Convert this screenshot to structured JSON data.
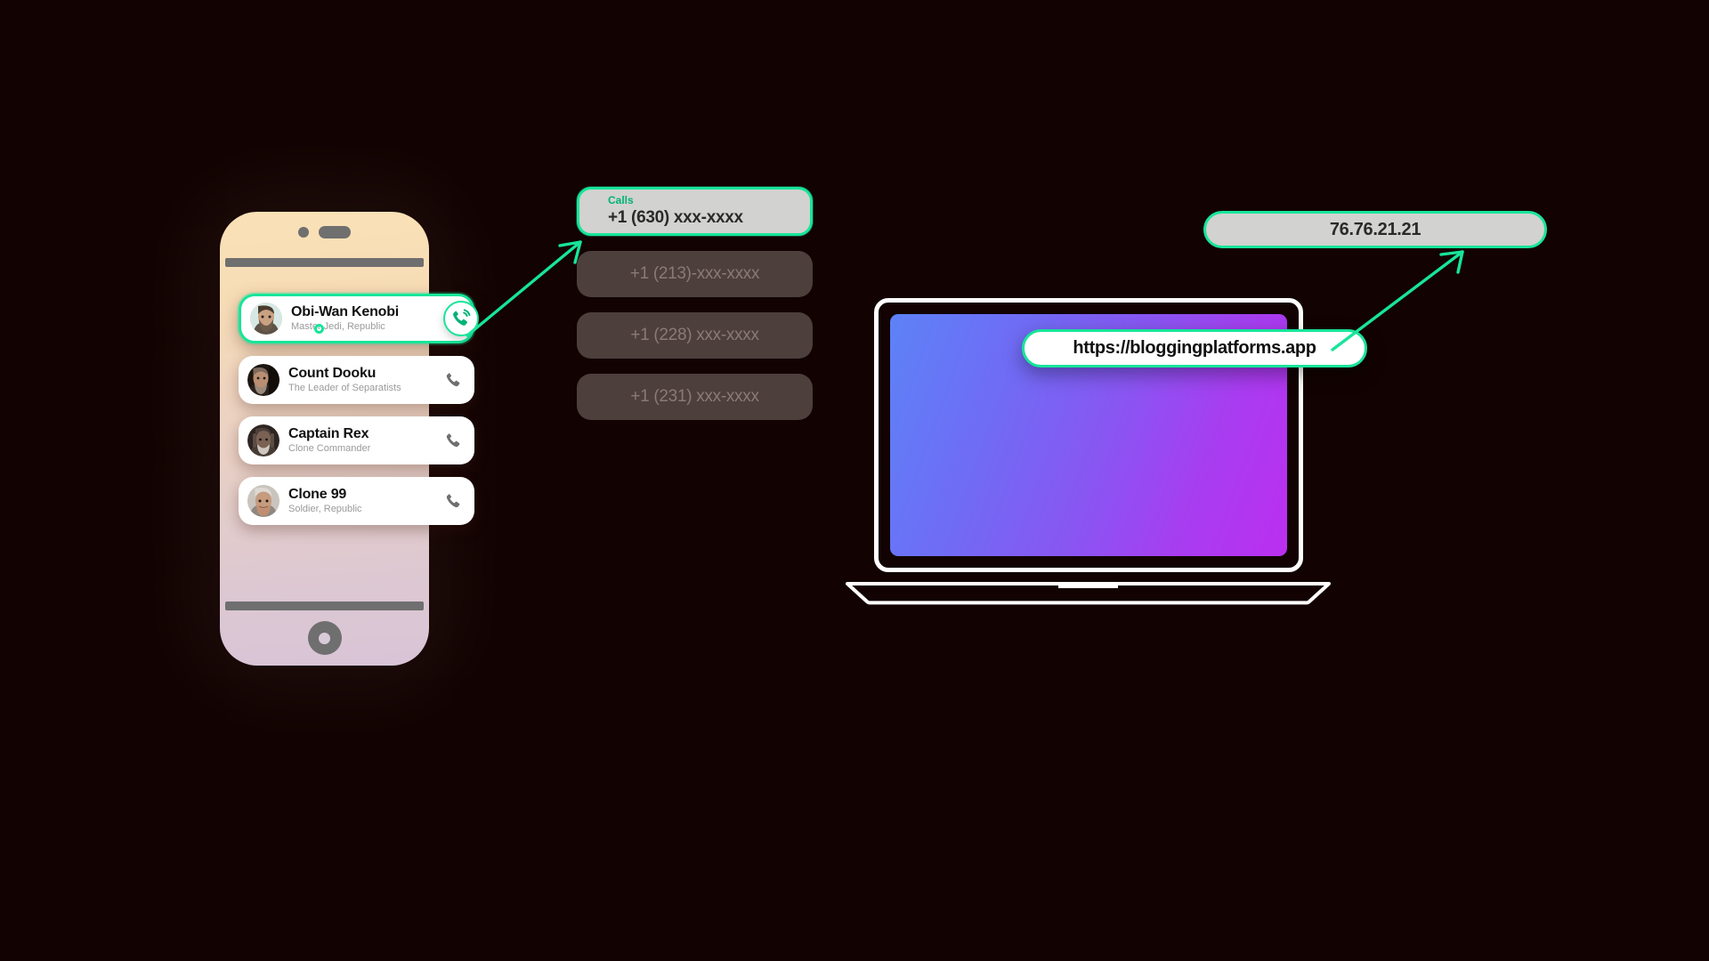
{
  "background_color": "#120302",
  "accent_color": "#17e59a",
  "phone": {
    "name": "phone-mockup",
    "body_gradient_from": "#fbe1b7",
    "body_gradient_to": "#d8c4d6",
    "contacts": [
      {
        "name": "Obi-Wan Kenobi",
        "role": "Master Jedi, Republic",
        "selected": true,
        "call_icon": "phone-call-wave-icon"
      },
      {
        "name": "Count Dooku",
        "role": "The Leader of Separatists",
        "selected": false,
        "call_icon": "phone-handset-icon"
      },
      {
        "name": "Captain Rex",
        "role": "Clone Commander",
        "selected": false,
        "call_icon": "phone-handset-icon"
      },
      {
        "name": "Clone 99",
        "role": "Soldier, Republic",
        "selected": false,
        "call_icon": "phone-handset-icon"
      }
    ]
  },
  "calls_panel": {
    "label": "Calls",
    "active_number": "+1 (630) xxx-xxxx",
    "active_card_bg": "#d2d2d0",
    "dimmed_numbers": [
      "+1 (213)-xxx-xxxx",
      "+1 (228) xxx-xxxx",
      "+1 (231) xxx-xxxx"
    ],
    "dimmed_card_bg": "#4c3f3c"
  },
  "laptop": {
    "name": "laptop-mockup",
    "screen_gradient_from": "#5d82f7",
    "screen_gradient_to": "#bb2ff0",
    "url": "https://bloggingplatforms.app"
  },
  "ip_pill": {
    "value": "76.76.21.21",
    "background": "#d2d2d0"
  },
  "arrows": [
    {
      "name": "arrow-phone-to-calls",
      "from": "call-button",
      "to": "calls-card"
    },
    {
      "name": "arrow-url-to-ip",
      "from": "url-pill",
      "to": "ip-pill"
    }
  ]
}
